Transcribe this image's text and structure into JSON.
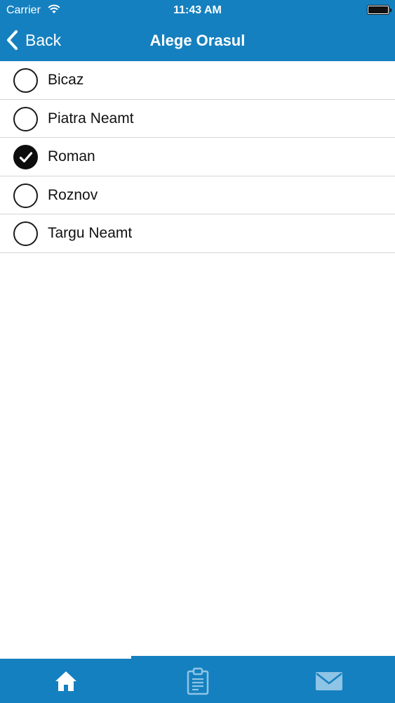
{
  "status_bar": {
    "carrier": "Carrier",
    "time": "11:43 AM"
  },
  "nav": {
    "back_label": "Back",
    "title": "Alege Orasul"
  },
  "cities": [
    {
      "name": "Bicaz",
      "selected": false
    },
    {
      "name": "Piatra Neamt",
      "selected": false
    },
    {
      "name": "Roman",
      "selected": true
    },
    {
      "name": "Roznov",
      "selected": false
    },
    {
      "name": "Targu Neamt",
      "selected": false
    }
  ],
  "tab_bar": {
    "tabs": [
      {
        "icon": "home-icon",
        "active": true
      },
      {
        "icon": "clipboard-icon",
        "active": false
      },
      {
        "icon": "mail-icon",
        "active": false
      }
    ]
  },
  "colors": {
    "accent": "#1580bf",
    "active_icon": "#ffffff",
    "inactive_icon": "#8ec4e6"
  }
}
